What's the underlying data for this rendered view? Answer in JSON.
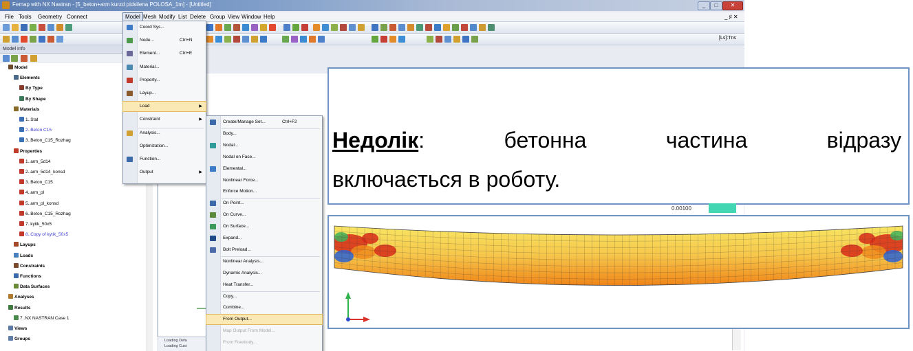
{
  "window": {
    "title": "Femap with NX Nastran - [5_beton+arm kurzd pidsilena POLOSA_1m] - [Untitled]",
    "min_glyph": "_",
    "max_glyph": "□",
    "close_glyph": "✕",
    "mdi_controls": "_ ♯ ✕"
  },
  "menubar": {
    "items": [
      "File",
      "Tools",
      "Geometry",
      "Connect",
      "Model",
      "Mesh",
      "Modify",
      "List",
      "Delete",
      "Group",
      "View",
      "Window",
      "Help"
    ],
    "active": "Model"
  },
  "toolbar": {
    "workplane_label": "[Ls]:Tns"
  },
  "model_info": {
    "panel_title": "Model Info",
    "tree": [
      {
        "label": "Model",
        "bold": true
      },
      {
        "label": "Elements",
        "bold": true
      },
      {
        "label": "By Type",
        "bold": true
      },
      {
        "label": "By Shape",
        "bold": true
      },
      {
        "label": "Materials",
        "bold": true
      },
      {
        "label": "1..Stal"
      },
      {
        "label": "2..Beton C15",
        "blue": true
      },
      {
        "label": "3..Beton_C15_Rozhag"
      },
      {
        "label": "Properties",
        "bold": true
      },
      {
        "label": "1..arm_5d14"
      },
      {
        "label": "2..arm_5d14_konsd"
      },
      {
        "label": "3..Beton_C15"
      },
      {
        "label": "4..arm_pl"
      },
      {
        "label": "5..arm_pl_konsd"
      },
      {
        "label": "6..Beton_C15_Rozhag"
      },
      {
        "label": "7..kytik_50x5"
      },
      {
        "label": "8..Copy of kytik_50x5",
        "blue": true
      },
      {
        "label": "Layups",
        "bold": true
      },
      {
        "label": "Loads",
        "bold": true
      },
      {
        "label": "Constraints",
        "bold": true
      },
      {
        "label": "Functions",
        "bold": true
      },
      {
        "label": "Data Surfaces",
        "bold": true
      },
      {
        "label": "Analyses",
        "bold": true
      },
      {
        "label": "Results",
        "bold": true
      },
      {
        "label": "7..NX NASTRAN Case 1"
      },
      {
        "label": "Views",
        "bold": true
      },
      {
        "label": "Groups",
        "bold": true
      }
    ]
  },
  "model_menu": {
    "items": [
      {
        "label": "Coord Sys...",
        "shortcut": ""
      },
      {
        "label": "Node...",
        "shortcut": "Ctrl+N"
      },
      {
        "label": "Element...",
        "shortcut": "Ctrl+E"
      },
      {
        "label": "Material...",
        "shortcut": ""
      },
      {
        "label": "Property...",
        "shortcut": ""
      },
      {
        "label": "Layup...",
        "shortcut": ""
      },
      {
        "label": "Load",
        "shortcut": "",
        "submenu": true,
        "highlighted": true
      },
      {
        "label": "Constraint",
        "shortcut": "",
        "submenu": true
      },
      {
        "label": "Analysis...",
        "shortcut": ""
      },
      {
        "label": "Optimization...",
        "shortcut": ""
      },
      {
        "label": "Function...",
        "shortcut": ""
      },
      {
        "label": "Output",
        "shortcut": "",
        "submenu": true
      }
    ]
  },
  "load_submenu": {
    "items": [
      {
        "label": "Create/Manage Set...",
        "shortcut": "Ctrl+F2"
      },
      {
        "label": "Body..."
      },
      {
        "label": "Nodal..."
      },
      {
        "label": "Nodal on Face..."
      },
      {
        "label": "Elemental..."
      },
      {
        "label": "Nonlinear Force..."
      },
      {
        "label": "Enforce Motion..."
      },
      {
        "label": "On Point..."
      },
      {
        "label": "On Curve..."
      },
      {
        "label": "On Surface..."
      },
      {
        "label": "Expand..."
      },
      {
        "label": "Bolt Preload..."
      },
      {
        "label": "Nonlinear Analysis..."
      },
      {
        "label": "Dynamic Analysis..."
      },
      {
        "label": "Heat Transfer..."
      },
      {
        "label": "Copy..."
      },
      {
        "label": "Combine..."
      },
      {
        "label": "From Output...",
        "highlighted": true
      },
      {
        "label": "Map Output From Model...",
        "disabled": true
      },
      {
        "label": "From Freebody...",
        "disabled": true
      }
    ]
  },
  "bottom_pane": {
    "line1": "Loading Defa",
    "line2": "Loading Cust"
  },
  "overlay": {
    "keyword": "Недолік",
    "colon": ":",
    "line1_words": [
      "бетонна",
      "частина",
      "відразу"
    ],
    "line2": "включається в роботу.",
    "value_readout": "0.00100"
  },
  "colors": {
    "slide_border": "#6f93c3",
    "menu_highlight": "#fbe9b5",
    "contour_low": "#f9f06b",
    "contour_mid": "#f08a1c",
    "contour_high": "#d72a17",
    "contour_extreme": "#2a63d6"
  }
}
